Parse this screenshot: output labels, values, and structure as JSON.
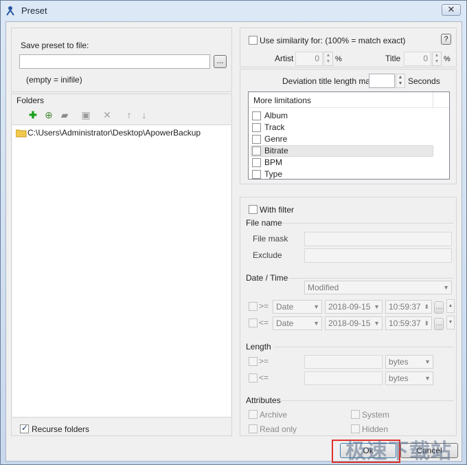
{
  "window": {
    "title": "Preset",
    "close_label": "✕"
  },
  "save": {
    "label": "Save preset to file:",
    "value": "",
    "browse": "...",
    "hint": "(empty = inifile)"
  },
  "folders": {
    "label": "Folders",
    "items": [
      "C:\\Users\\Administrator\\Desktop\\ApowerBackup"
    ],
    "recurse_label": "Recurse folders",
    "recurse_checked": true
  },
  "similarity": {
    "label": "Use similarity for: (100% = match exact)",
    "help": "?",
    "artist_label": "Artist",
    "artist_value": "0",
    "artist_unit": "%",
    "title_label": "Title",
    "title_value": "0",
    "title_unit": "%"
  },
  "deviation": {
    "label": "Deviation title length max.",
    "value": "",
    "unit": "Seconds"
  },
  "limitations": {
    "header": "More limitations",
    "items": [
      "Album",
      "Track",
      "Genre",
      "Bitrate",
      "BPM",
      "Type"
    ]
  },
  "filter": {
    "with_filter": "With filter",
    "file_name": "File name",
    "file_mask": "File mask",
    "exclude": "Exclude"
  },
  "datetime": {
    "label": "Date / Time",
    "mode": "Modified",
    "rows": [
      {
        "op": ">=",
        "kind": "Date",
        "date": "2018-09-15",
        "time": "10:59:37",
        "more": "..."
      },
      {
        "op": "<=",
        "kind": "Date",
        "date": "2018-09-15",
        "time": "10:59:37",
        "more": "..."
      }
    ]
  },
  "length": {
    "label": "Length",
    "rows": [
      {
        "op": ">=",
        "unit": "bytes"
      },
      {
        "op": "<=",
        "unit": "bytes"
      }
    ]
  },
  "attributes": {
    "label": "Attributes",
    "archive": "Archive",
    "system": "System",
    "read_only": "Read only",
    "hidden": "Hidden"
  },
  "footer": {
    "ok": "Ok",
    "cancel": "Cancel"
  },
  "watermark": "极速下载站"
}
